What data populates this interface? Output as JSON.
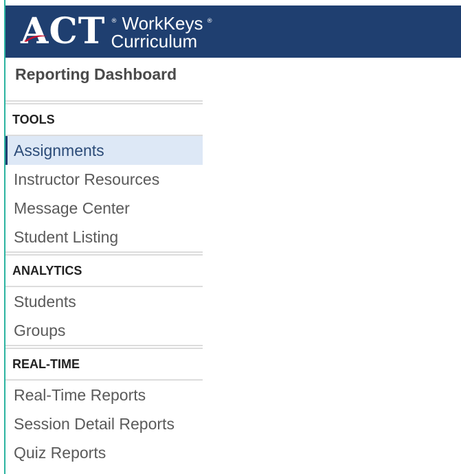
{
  "header": {
    "brand_act": "ACT",
    "brand_reg": "®",
    "brand_line1": "WorkKeys",
    "brand_line1_mark": "®",
    "brand_line2": "Curriculum"
  },
  "page_title": "Reporting Dashboard",
  "sections": [
    {
      "title": "TOOLS",
      "items": [
        "Assignments",
        "Instructor Resources",
        "Message Center",
        "Student Listing"
      ],
      "active_index": 0
    },
    {
      "title": "ANALYTICS",
      "items": [
        "Students",
        "Groups"
      ]
    },
    {
      "title": "REAL-TIME",
      "items": [
        "Real-Time Reports",
        "Session Detail Reports",
        "Quiz Reports"
      ]
    }
  ],
  "colors": {
    "header_bg": "#1f3f70",
    "active_bg": "#dde8f6",
    "accent_red": "#c8102e",
    "edge_teal": "#2ab3a0"
  }
}
